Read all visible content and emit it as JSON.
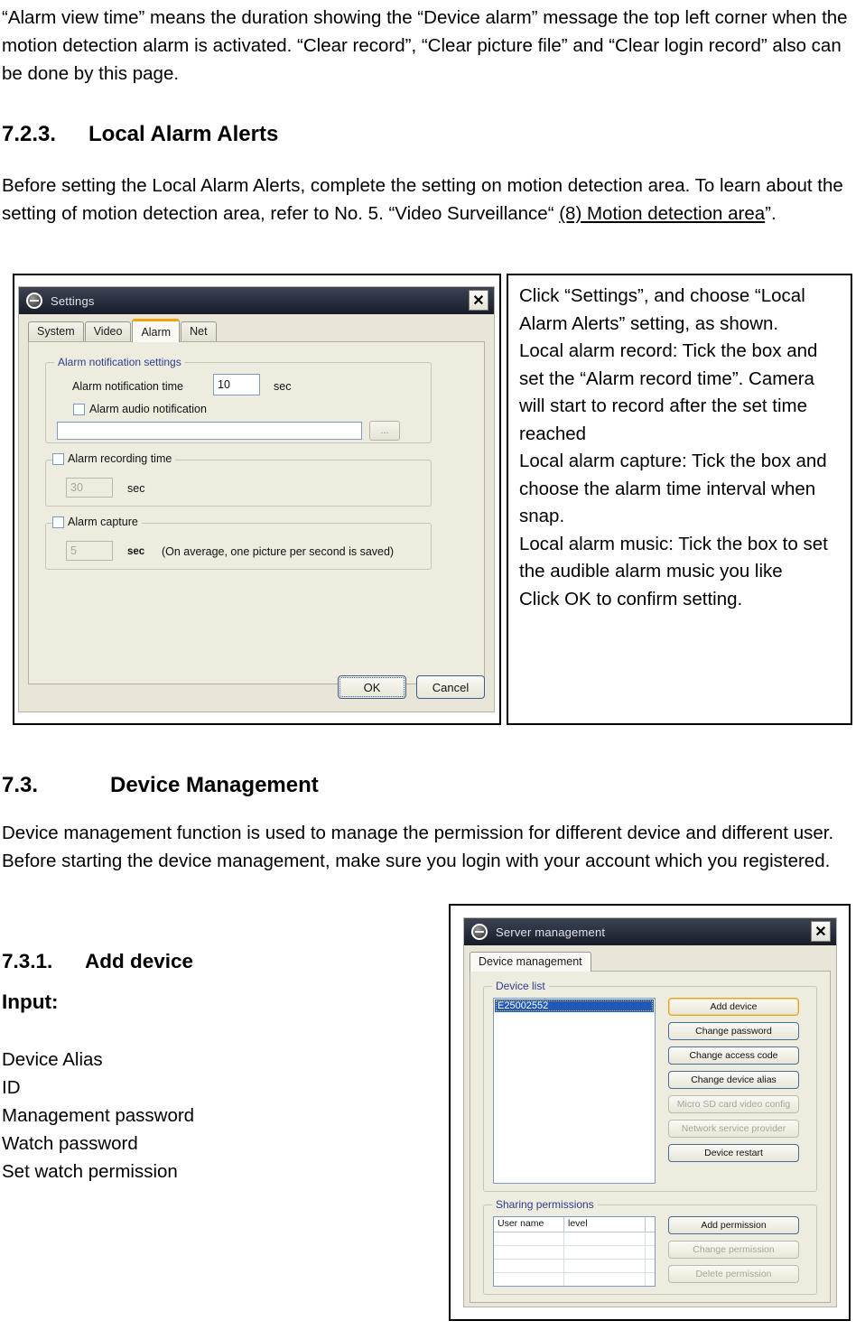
{
  "document": {
    "intro_paragraph": "“Alarm view time” means the duration showing the “Device alarm” message the top left corner when the motion detection alarm is activated. “Clear record”, “Clear picture file” and “Clear login record” also can be done by this page.",
    "section_723_number": "7.2.3.",
    "section_723_title": "Local Alarm Alerts",
    "section_723_body_1": "Before setting the Local Alarm Alerts, complete the setting on motion detection area. To learn about the setting of motion detection area, refer to No. 5. “Video Surveillance“ ",
    "section_723_link": "(8) Motion detection area",
    "section_723_body_2": "”.",
    "section_73_number": "7.3.",
    "section_73_title": "Device Management",
    "section_73_body": "Device management function is used to manage the permission for different device and different user. Before starting the device management, make sure you login with your account which you registered.",
    "section_731_number": "7.3.1.",
    "section_731_title": "Add device",
    "input_label": "Input:",
    "input_items": [
      "Device Alias",
      "ID",
      "Management password",
      "Watch password",
      "Set watch permission"
    ]
  },
  "note_box": {
    "lines": [
      "Click “Settings”, and choose “Local Alarm Alerts” setting, as shown.",
      "Local alarm record: Tick the box and set the “Alarm record time”. Camera will start to record after the set time reached",
      "Local alarm capture: Tick the box and choose the alarm time interval when snap.",
      "Local alarm music: Tick the box to set the audible alarm music you like",
      "Click OK to confirm setting."
    ]
  },
  "settings_dialog": {
    "title": "Settings",
    "close_label": "✕",
    "tabs": [
      {
        "label": "System",
        "active": false
      },
      {
        "label": "Video",
        "active": false
      },
      {
        "label": "Alarm",
        "active": true
      },
      {
        "label": "Net",
        "active": false
      }
    ],
    "group_notification": {
      "title": "Alarm notification settings",
      "time_label": "Alarm notification time",
      "time_value": "10",
      "time_unit": "sec",
      "audio_checkbox_label": "Alarm audio notification",
      "audio_path_value": "",
      "browse_label": "..."
    },
    "group_recording": {
      "title": "Alarm recording time",
      "value": "30",
      "unit": "sec"
    },
    "group_capture": {
      "title": "Alarm capture",
      "value": "5",
      "unit": "sec",
      "hint": "(On average, one picture per second is saved)"
    },
    "ok_label": "OK",
    "cancel_label": "Cancel"
  },
  "server_dialog": {
    "title": "Server management",
    "close_label": "✕",
    "tabs": [
      {
        "label": "Device management",
        "active": true
      }
    ],
    "device_list": {
      "title": "Device list",
      "items": [
        "E25002552"
      ],
      "buttons": [
        {
          "label": "Add device",
          "state": "primary"
        },
        {
          "label": "Change password",
          "state": "enabled"
        },
        {
          "label": "Change access code",
          "state": "enabled"
        },
        {
          "label": "Change device alias",
          "state": "enabled"
        },
        {
          "label": "Micro SD card video config",
          "state": "disabled"
        },
        {
          "label": "Network service provider",
          "state": "disabled"
        },
        {
          "label": "Device restart",
          "state": "enabled"
        }
      ]
    },
    "sharing_permissions": {
      "title": "Sharing permissions",
      "columns": [
        "User name",
        "level"
      ],
      "rows": [],
      "row_count": 7,
      "buttons": [
        {
          "label": "Add permission",
          "state": "enabled"
        },
        {
          "label": "Change permission",
          "state": "disabled"
        },
        {
          "label": "Delete permission",
          "state": "disabled"
        }
      ]
    }
  },
  "colors": {
    "dialog_face": "#e9e6d9",
    "titlebar_dark": "#171c27",
    "tab_accent": "#f0a30a",
    "group_title_blue": "#2c3f8f",
    "selection_blue": "#2159b8"
  }
}
